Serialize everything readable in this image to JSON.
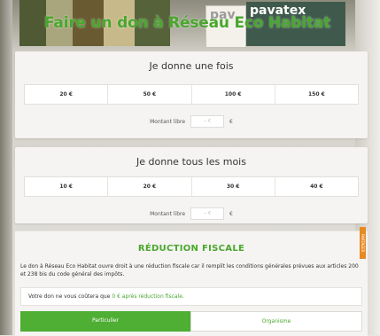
{
  "page": {
    "title": "Faire un don à Réseau Eco Habitat"
  },
  "background": {
    "brand_left": "pav",
    "brand_right": "pavatex"
  },
  "once": {
    "title": "Je donne une fois",
    "amounts": [
      "20 €",
      "50 €",
      "100 €",
      "150 €"
    ],
    "free_label": "Montant libre",
    "free_placeholder": "-- €",
    "currency": "€"
  },
  "monthly": {
    "title": "Je donne tous les mois",
    "amounts": [
      "10 €",
      "20 €",
      "30 €",
      "40 €"
    ],
    "free_label": "Montant libre",
    "free_placeholder": "-- €",
    "currency": "€"
  },
  "tax": {
    "title": "RÉDUCTION FISCALE",
    "text": "Le don à Réseau Eco Habitat ouvre droit à une réduction fiscale car il remplit les conditions générales prévues aux articles 200 et 238 bis du code général des impôts.",
    "cost_prefix": "Votre don ne vous coûtera que",
    "cost_value": "0 € après réduction fiscale.",
    "tabs": [
      "Particulier",
      "Organisme"
    ],
    "side_badge": "PARTAGER"
  },
  "colors": {
    "accent_green": "#4fae34",
    "badge_orange": "#e78a25"
  }
}
